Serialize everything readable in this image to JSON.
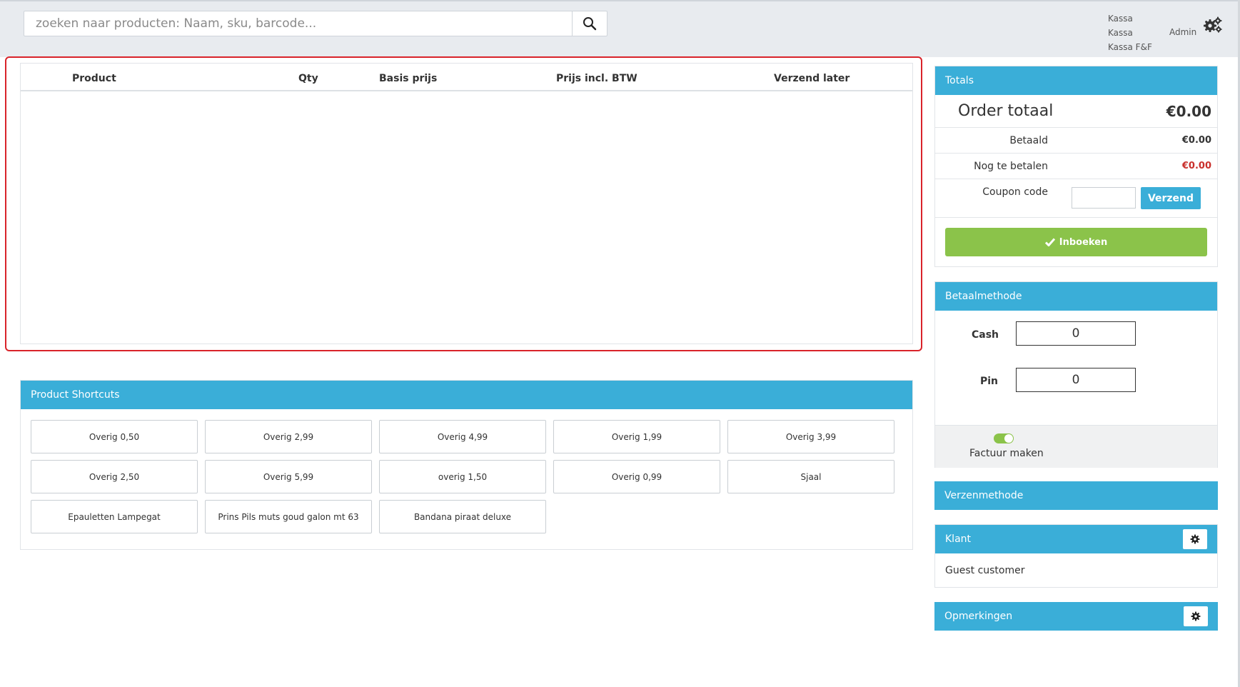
{
  "search": {
    "placeholder": "zoeken naar producten: Naam, sku, barcode..."
  },
  "header": {
    "stores": [
      "Kassa",
      "Kassa",
      "Kassa F&F"
    ],
    "user": "Admin"
  },
  "cart": {
    "columns": [
      "Product",
      "Qty",
      "Basis prijs",
      "Prijs incl. BTW",
      "Verzend later"
    ]
  },
  "shortcuts": {
    "title": "Product Shortcuts",
    "items": [
      "Overig 0,50",
      "Overig 2,99",
      "Overig 4,99",
      "Overig 1,99",
      "Overig 3,99",
      "Overig 2,50",
      "Overig 5,99",
      "overig 1,50",
      "Overig 0,99",
      "Sjaal",
      "Epauletten Lampegat",
      "Prins Pils muts goud galon mt 63",
      "Bandana piraat deluxe"
    ]
  },
  "totals": {
    "title": "Totals",
    "order_total_label": "Order totaal",
    "order_total_value": "€0.00",
    "paid_label": "Betaald",
    "paid_value": "€0.00",
    "due_label": "Nog te betalen",
    "due_value": "€0.00",
    "coupon_label": "Coupon code",
    "coupon_button": "Verzend",
    "book_button": "Inboeken"
  },
  "payment": {
    "title": "Betaalmethode",
    "cash_label": "Cash",
    "cash_value": "0",
    "pin_label": "Pin",
    "pin_value": "0",
    "invoice_label": "Factuur maken"
  },
  "shipping": {
    "title": "Verzenmethode"
  },
  "customer": {
    "title": "Klant",
    "name": "Guest customer"
  },
  "notes": {
    "title": "Opmerkingen"
  },
  "colors": {
    "accent": "#3aaed8",
    "success": "#8bc34a",
    "danger": "#c9302c",
    "highlight": "#d9232a"
  }
}
